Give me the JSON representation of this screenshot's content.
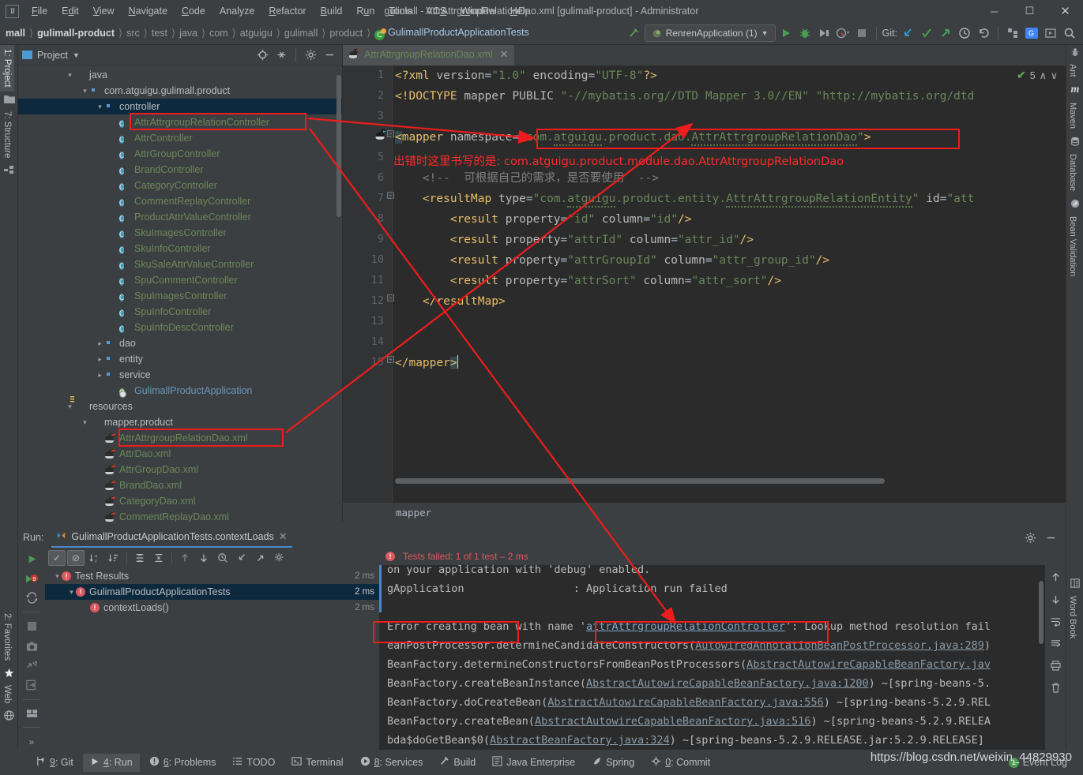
{
  "window": {
    "title": "gulimall - AttrAttrgroupRelationDao.xml [gulimall-product] - Administrator",
    "minimize": "─",
    "maximize": "☐",
    "close": "✕",
    "logo": "IJ"
  },
  "menu": [
    "File",
    "Edit",
    "View",
    "Navigate",
    "Code",
    "Analyze",
    "Refactor",
    "Build",
    "Run",
    "Tools",
    "VCS",
    "Window",
    "Help"
  ],
  "navbar": {
    "crumbs": [
      {
        "label": "mall",
        "style": "bold"
      },
      {
        "label": "gulimall-product",
        "style": "bold"
      },
      {
        "label": "src",
        "style": "dim"
      },
      {
        "label": "test",
        "style": "dim"
      },
      {
        "label": "java",
        "style": "dim"
      },
      {
        "label": "com",
        "style": "dim"
      },
      {
        "label": "atguigu",
        "style": "dim"
      },
      {
        "label": "gulimall",
        "style": "dim"
      },
      {
        "label": "product",
        "style": "dim"
      },
      {
        "label": "GulimallProductApplicationTests",
        "style": "class"
      }
    ],
    "run_config": "RenrenApplication (1)",
    "git_label": "Git:",
    "icons": [
      "run-icon",
      "debug-icon",
      "coverage-icon",
      "profile-icon",
      "stop-icon",
      "git-update-icon",
      "git-commit-icon",
      "git-push-icon",
      "history-icon",
      "rollback-icon",
      "structure-icon",
      "translate-icon",
      "preview-icon",
      "search-icon"
    ]
  },
  "left_strip": {
    "top": [
      {
        "label": "1: Project",
        "selected": true
      },
      {
        "label": "7: Structure",
        "selected": false
      }
    ],
    "bottom": [
      {
        "label": "2: Favorites"
      },
      {
        "label": "Web"
      }
    ]
  },
  "right_strip": [
    "Ant",
    "Maven",
    "Database",
    "Bean Validation",
    "Word Book"
  ],
  "project_panel": {
    "title": "Project",
    "tree": [
      {
        "indent": 3,
        "arrow": "v",
        "icon": "folder-src",
        "label": "java",
        "color": "white"
      },
      {
        "indent": 4,
        "arrow": "v",
        "icon": "package",
        "label": "com.atguigu.gulimall.product",
        "color": "white"
      },
      {
        "indent": 5,
        "arrow": "v",
        "icon": "package",
        "label": "controller",
        "color": "white",
        "selected": true
      },
      {
        "indent": 6,
        "arrow": "",
        "icon": "class",
        "label": "AttrAttrgroupRelationController",
        "color": "green",
        "boxed": true
      },
      {
        "indent": 6,
        "arrow": "",
        "icon": "class",
        "label": "AttrController",
        "color": "green"
      },
      {
        "indent": 6,
        "arrow": "",
        "icon": "class",
        "label": "AttrGroupController",
        "color": "green"
      },
      {
        "indent": 6,
        "arrow": "",
        "icon": "class",
        "label": "BrandController",
        "color": "green"
      },
      {
        "indent": 6,
        "arrow": "",
        "icon": "class",
        "label": "CategoryController",
        "color": "green"
      },
      {
        "indent": 6,
        "arrow": "",
        "icon": "class",
        "label": "CommentReplayController",
        "color": "green"
      },
      {
        "indent": 6,
        "arrow": "",
        "icon": "class",
        "label": "ProductAttrValueController",
        "color": "green"
      },
      {
        "indent": 6,
        "arrow": "",
        "icon": "class",
        "label": "SkuImagesController",
        "color": "green"
      },
      {
        "indent": 6,
        "arrow": "",
        "icon": "class",
        "label": "SkuInfoController",
        "color": "green"
      },
      {
        "indent": 6,
        "arrow": "",
        "icon": "class",
        "label": "SkuSaleAttrValueController",
        "color": "green"
      },
      {
        "indent": 6,
        "arrow": "",
        "icon": "class",
        "label": "SpuCommentController",
        "color": "green"
      },
      {
        "indent": 6,
        "arrow": "",
        "icon": "class",
        "label": "SpuImagesController",
        "color": "green"
      },
      {
        "indent": 6,
        "arrow": "",
        "icon": "class",
        "label": "SpuInfoController",
        "color": "green"
      },
      {
        "indent": 6,
        "arrow": "",
        "icon": "class",
        "label": "SpuInfoDescController",
        "color": "green"
      },
      {
        "indent": 5,
        "arrow": ">",
        "icon": "package",
        "label": "dao",
        "color": "white"
      },
      {
        "indent": 5,
        "arrow": ">",
        "icon": "package",
        "label": "entity",
        "color": "white"
      },
      {
        "indent": 5,
        "arrow": ">",
        "icon": "package",
        "label": "service",
        "color": "white"
      },
      {
        "indent": 6,
        "arrow": "",
        "icon": "spring-app",
        "label": "GulimallProductApplication",
        "color": "blue"
      },
      {
        "indent": 3,
        "arrow": "v",
        "icon": "folder-res",
        "label": "resources",
        "color": "white"
      },
      {
        "indent": 4,
        "arrow": "v",
        "icon": "folder",
        "label": "mapper.product",
        "color": "white"
      },
      {
        "indent": 5,
        "arrow": "",
        "icon": "mybatis",
        "label": "AttrAttrgroupRelationDao.xml",
        "color": "green",
        "boxed": true
      },
      {
        "indent": 5,
        "arrow": "",
        "icon": "mybatis",
        "label": "AttrDao.xml",
        "color": "green"
      },
      {
        "indent": 5,
        "arrow": "",
        "icon": "mybatis",
        "label": "AttrGroupDao.xml",
        "color": "green"
      },
      {
        "indent": 5,
        "arrow": "",
        "icon": "mybatis",
        "label": "BrandDao.xml",
        "color": "green"
      },
      {
        "indent": 5,
        "arrow": "",
        "icon": "mybatis",
        "label": "CategoryDao.xml",
        "color": "green"
      },
      {
        "indent": 5,
        "arrow": "",
        "icon": "mybatis",
        "label": "CommentReplayDao.xml",
        "color": "green"
      }
    ]
  },
  "editor": {
    "tab": {
      "label": "AttrAttrgroupRelationDao.xml",
      "close": "✕"
    },
    "inspection": {
      "count": "5",
      "up": "∧",
      "down": "∨"
    },
    "breadcrumb": "mapper",
    "line_numbers": [
      "1",
      "2",
      "3",
      "4",
      "5",
      "6",
      "7",
      "8",
      "9",
      "10",
      "11",
      "12",
      "13",
      "14",
      "15"
    ],
    "lines": [
      "<?xml version=\"1.0\" encoding=\"UTF-8\"?>",
      "<!DOCTYPE mapper PUBLIC \"-//mybatis.org//DTD Mapper 3.0//EN\" \"http://mybatis.org/dtd",
      "",
      "<mapper namespace=\"com.atguigu.product.dao.AttrAttrgroupRelationDao\">",
      "",
      "    <!-- 可根据自己的需求，是否要使用 -->",
      "    <resultMap type=\"com.atguigu.product.entity.AttrAttrgroupRelationEntity\" id=\"att",
      "        <result property=\"id\" column=\"id\"/>",
      "        <result property=\"attrId\" column=\"attr_id\"/>",
      "        <result property=\"attrGroupId\" column=\"attr_group_id\"/>",
      "        <result property=\"attrSort\" column=\"attr_sort\"/>",
      "    </resultMap>",
      "",
      "",
      "</mapper>"
    ],
    "annotation_note": "出错时这里书写的是: com.atguigu.product.module.dao.AttrAttrgroupRelationDao"
  },
  "run_window": {
    "label": "Run:",
    "tab": "GulimallProductApplicationTests.contextLoads",
    "tab_close": "✕",
    "toolbar_icons": [
      "rerun-icon",
      "rerun-failed-icon",
      "toggle-auto-test-icon",
      "stop-icon",
      "screenshot-icon",
      "export-icon",
      "import-icon",
      "layout-icon",
      "expand-more-icon"
    ],
    "test_toolbar_icons": [
      "show-passed-icon",
      "show-ignored-icon",
      "sort-alpha-icon",
      "sort-duration-icon",
      "expand-all-icon",
      "collapse-all-icon",
      "prev-icon",
      "next-icon",
      "history-icon",
      "import-icon",
      "export-icon",
      "settings-icon"
    ],
    "tests": [
      {
        "label": "Test Results",
        "time": "2 ms",
        "indent": 0,
        "arrow": "v"
      },
      {
        "label": "GulimallProductApplicationTests",
        "time": "2 ms",
        "indent": 1,
        "arrow": "v",
        "selected": true
      },
      {
        "label": "contextLoads()",
        "time": "2 ms",
        "indent": 2,
        "arrow": ""
      }
    ],
    "status": "Tests failed: 1 of 1 test – 2 ms",
    "console": [
      "on your application with 'debug' enabled.",
      "gApplication                 : Application run failed",
      "",
      "Error creating bean with name 'attrAttrgroupRelationController': Lookup method resolution fail",
      "eanPostProcessor.determineCandidateConstructors(AutowiredAnnotationBeanPostProcessor.java:289)",
      "BeanFactory.determineConstructorsFromBeanPostProcessors(AbstractAutowireCapableBeanFactory.jav",
      "BeanFactory.createBeanInstance(AbstractAutowireCapableBeanFactory.java:1200) ~[spring-beans-5.",
      "BeanFactory.doCreateBean(AbstractAutowireCapableBeanFactory.java:556) ~[spring-beans-5.2.9.REL",
      "BeanFactory.createBean(AbstractAutowireCapableBeanFactory.java:516) ~[spring-beans-5.2.9.RELEA",
      "bda$doGetBean$0(AbstractBeanFactory.java:324) ~[spring-beans-5.2.9.RELEASE.jar:5.2.9.RELEASE]"
    ],
    "console_side_icons": [
      "scroll-up-icon",
      "scroll-down-icon",
      "soft-wrap-icon",
      "scroll-end-icon",
      "print-icon",
      "clear-icon"
    ]
  },
  "statusbar": {
    "items": [
      {
        "label": "9: Git",
        "key": "9",
        "icon": "git-icon",
        "selected": false
      },
      {
        "label": "4: Run",
        "key": "4",
        "icon": "run-icon",
        "selected": true
      },
      {
        "label": "6: Problems",
        "key": "6",
        "icon": "problems-icon",
        "selected": false
      },
      {
        "label": "TODO",
        "key": "",
        "icon": "todo-icon",
        "selected": false
      },
      {
        "label": "Terminal",
        "key": "",
        "icon": "terminal-icon",
        "selected": false
      },
      {
        "label": "8: Services",
        "key": "8",
        "icon": "services-icon",
        "selected": false
      },
      {
        "label": "Build",
        "key": "",
        "icon": "build-icon",
        "selected": false
      },
      {
        "label": "Java Enterprise",
        "key": "",
        "icon": "java-enterprise-icon",
        "selected": false
      },
      {
        "label": "Spring",
        "key": "",
        "icon": "spring-icon",
        "selected": false
      },
      {
        "label": "0: Commit",
        "key": "0",
        "icon": "commit-icon",
        "selected": false
      }
    ],
    "event_log": "Event Log",
    "event_badge": "1"
  },
  "watermark": "https://blog.csdn.net/weixin_44829930",
  "colors": {
    "accent": "#4a88c7",
    "annotation_red": "#ee1c1c",
    "error_red": "#db5860",
    "string_green": "#6a8759",
    "tag_yellow": "#e8bf6a",
    "selection_blue": "#0d293e"
  }
}
